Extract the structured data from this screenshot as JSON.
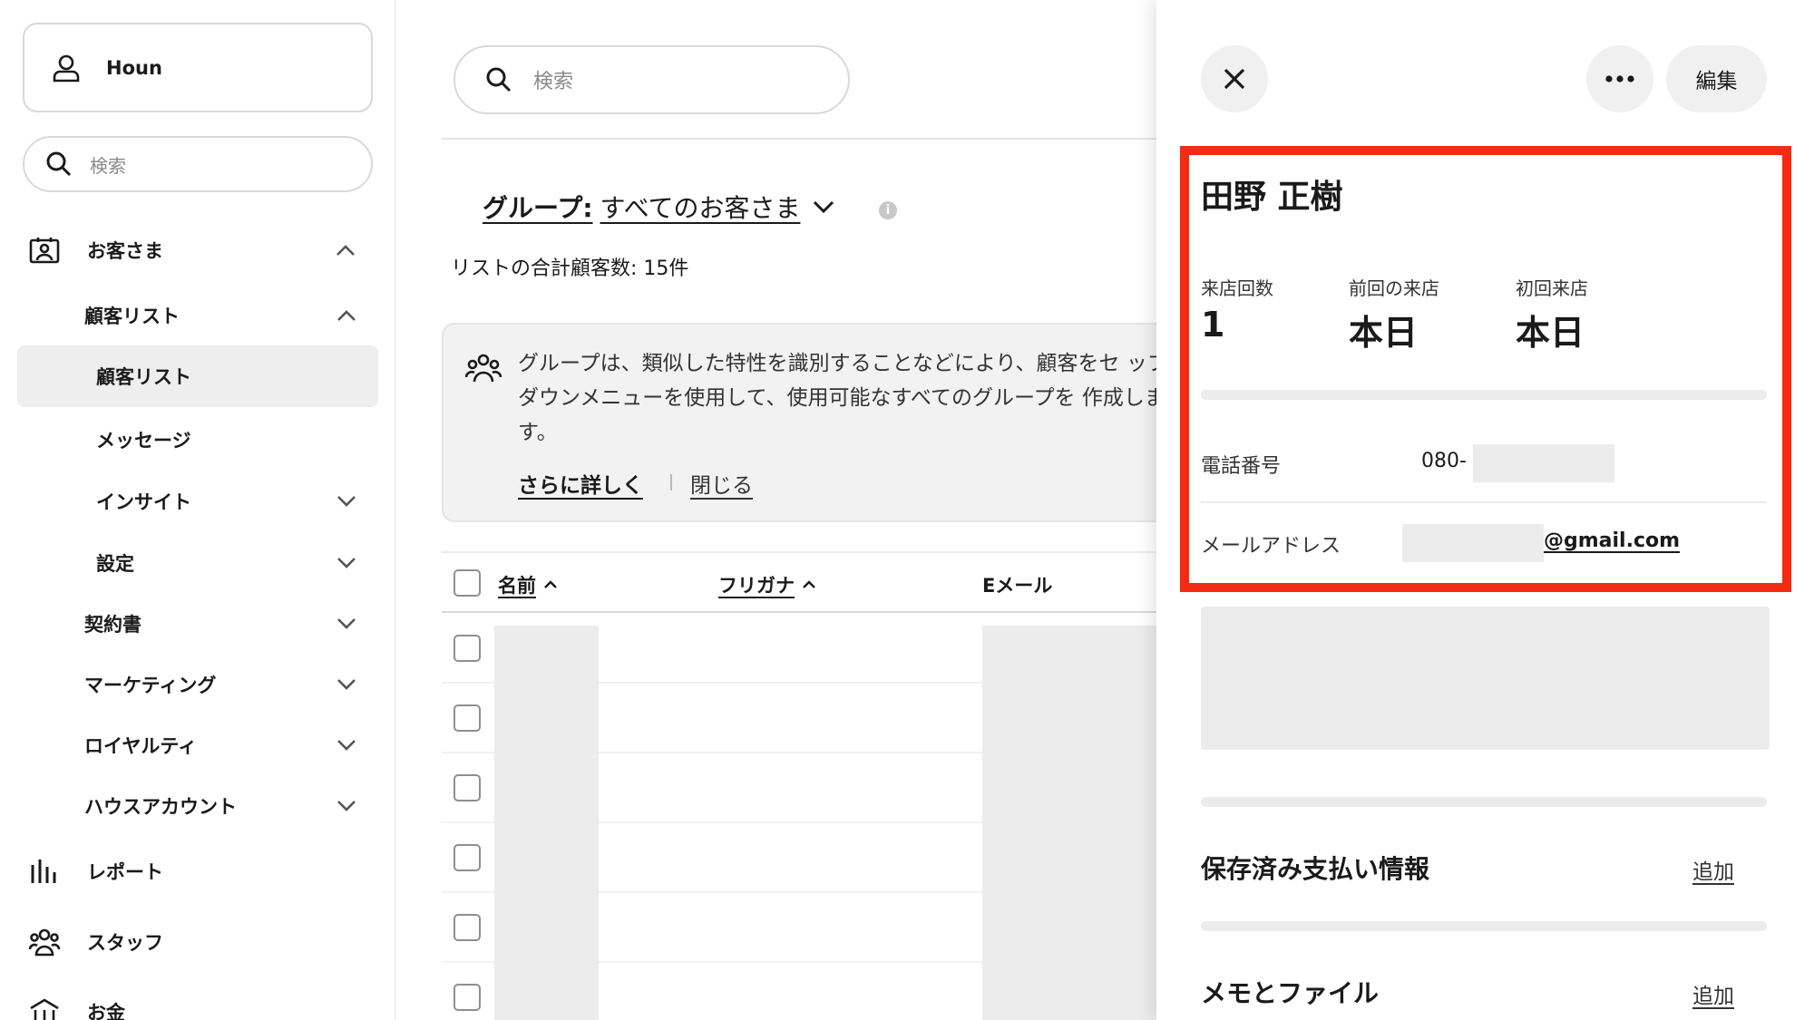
{
  "sidebar": {
    "profile_name": "Houn",
    "search_placeholder": "検索",
    "items": [
      {
        "label": "お客さま"
      },
      {
        "label": "顧客リスト"
      },
      {
        "label": "顧客リスト"
      },
      {
        "label": "メッセージ"
      },
      {
        "label": "インサイト"
      },
      {
        "label": "設定"
      },
      {
        "label": "契約書"
      },
      {
        "label": "マーケティング"
      },
      {
        "label": "ロイヤルティ"
      },
      {
        "label": "ハウスアカウント"
      },
      {
        "label": "レポート"
      },
      {
        "label": "スタッフ"
      },
      {
        "label": "お金"
      }
    ]
  },
  "main": {
    "search_placeholder": "検索",
    "group_label": "グループ:",
    "group_value": "すべてのお客さま",
    "customer_count": "リストの合計顧客数: 15件",
    "banner": {
      "text": "グループは、類似した特性を識別することなどにより、顧客をセ ップダウンメニューを使用して、使用可能なすべてのグループを 作成します。",
      "learn_more": "さらに詳しく",
      "close": "閉じる"
    },
    "table": {
      "columns": [
        "名前",
        "フリガナ",
        "Eメール"
      ]
    }
  },
  "panel": {
    "edit_label": "編集",
    "customer_name": "田野 正樹",
    "stats": [
      {
        "label": "来店回数",
        "value": "1"
      },
      {
        "label": "前回の来店",
        "value": "本日"
      },
      {
        "label": "初回来店",
        "value": "本日"
      }
    ],
    "phone_label": "電話番号",
    "phone_value": "080-",
    "email_label": "メールアドレス",
    "email_value": "@gmail.com",
    "saved_payment_title": "保存済み支払い情報",
    "saved_payment_add": "追加",
    "notes_title": "メモとファイル",
    "notes_add": "追加",
    "highlight_color": "#f52a12"
  }
}
